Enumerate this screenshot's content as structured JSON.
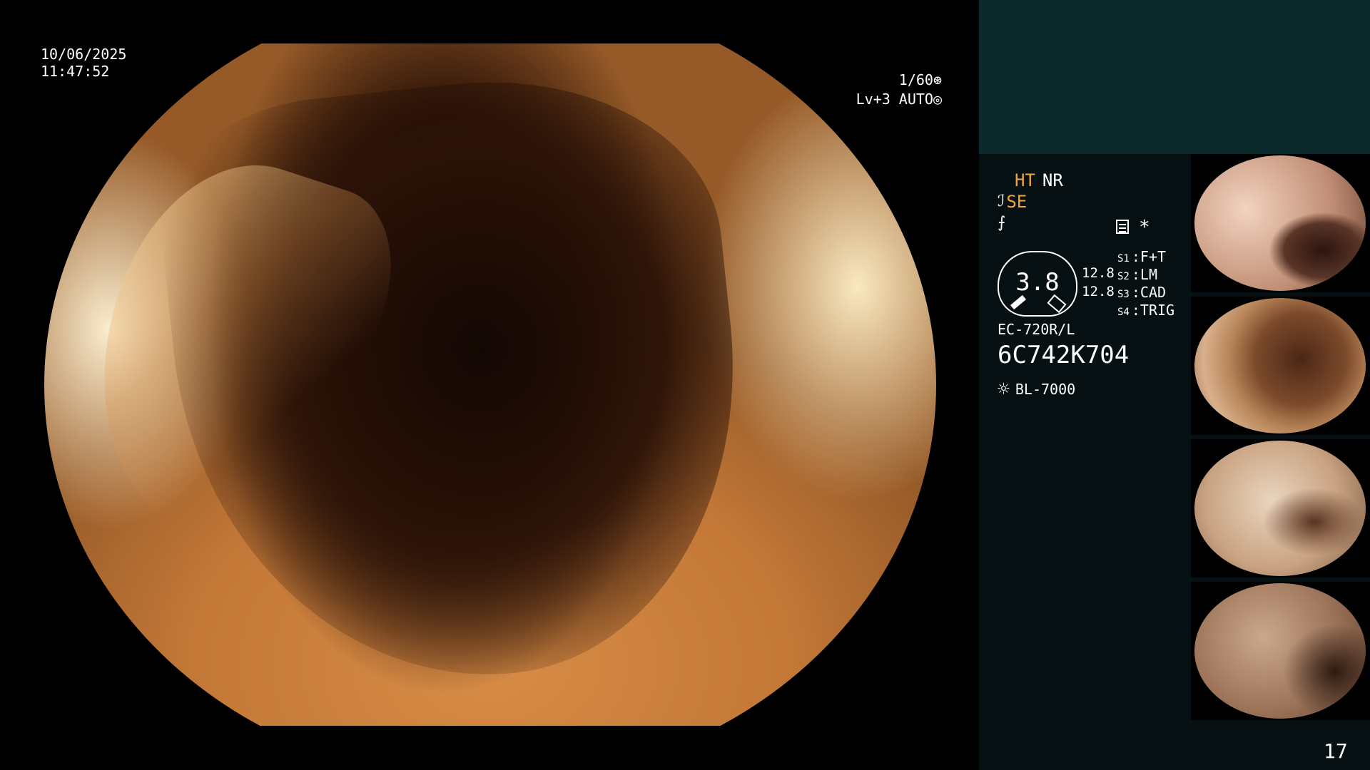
{
  "overlay": {
    "date": "10/06/2025",
    "time": "11:47:52",
    "shutter": "1/60⊛",
    "level": "Lv+3 AUTO◎"
  },
  "panel": {
    "status": {
      "ht": "HT",
      "nr": "NR",
      "se_symbol": "ℐ",
      "se": "SE",
      "f_symbol": "⨍"
    },
    "gauge": {
      "value": "3.8",
      "num1": "12.8",
      "num2": "12.8"
    },
    "settings_icon": "settings-icon",
    "asterisk": "*",
    "switches": [
      {
        "key": "S1",
        "value": "F+T"
      },
      {
        "key": "S2",
        "value": "LM"
      },
      {
        "key": "S3",
        "value": "CAD"
      },
      {
        "key": "S4",
        "value": "TRIG"
      }
    ],
    "scope_model": "EC-720R/L",
    "serial": "6C742K704",
    "light": {
      "icon": "sun-icon",
      "label": "BL-7000"
    }
  },
  "thumbnails": [
    {
      "label": "thumbnail 1"
    },
    {
      "label": "thumbnail 2"
    },
    {
      "label": "thumbnail 3"
    },
    {
      "label": "thumbnail 4"
    }
  ],
  "page_number": "17",
  "colors": {
    "accent_orange": "#f0a63a",
    "panel_bg": "#071012",
    "panel_top": "#0b2a2c"
  }
}
